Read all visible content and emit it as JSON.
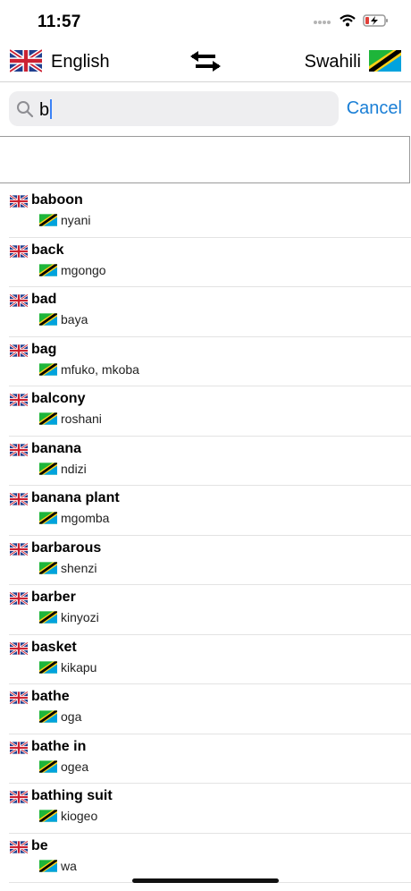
{
  "status": {
    "time": "11:57"
  },
  "languages": {
    "left": "English",
    "right": "Swahili"
  },
  "search": {
    "value": "b",
    "cancel_label": "Cancel"
  },
  "results": [
    {
      "en": "baboon",
      "sw": "nyani"
    },
    {
      "en": "back",
      "sw": "mgongo"
    },
    {
      "en": "bad",
      "sw": "baya"
    },
    {
      "en": "bag",
      "sw": "mfuko, mkoba"
    },
    {
      "en": "balcony",
      "sw": "roshani"
    },
    {
      "en": "banana",
      "sw": "ndizi"
    },
    {
      "en": "banana plant",
      "sw": "mgomba"
    },
    {
      "en": "barbarous",
      "sw": "shenzi"
    },
    {
      "en": "barber",
      "sw": "kinyozi"
    },
    {
      "en": "basket",
      "sw": "kikapu"
    },
    {
      "en": "bathe",
      "sw": "oga"
    },
    {
      "en": "bathe in",
      "sw": "ogea"
    },
    {
      "en": "bathing suit",
      "sw": "kiogeo"
    },
    {
      "en": "be",
      "sw": "wa"
    }
  ],
  "icons": {
    "signal": "cellular-signal-icon",
    "wifi": "wifi-icon",
    "battery": "battery-charging-icon",
    "swap": "swap-arrows-icon",
    "search": "magnifier-icon",
    "source_flag": "uk-flag-icon",
    "target_flag": "tanzania-flag-icon"
  },
  "colors": {
    "accent": "#1a7fd6",
    "battery_low": "#e0403a"
  }
}
